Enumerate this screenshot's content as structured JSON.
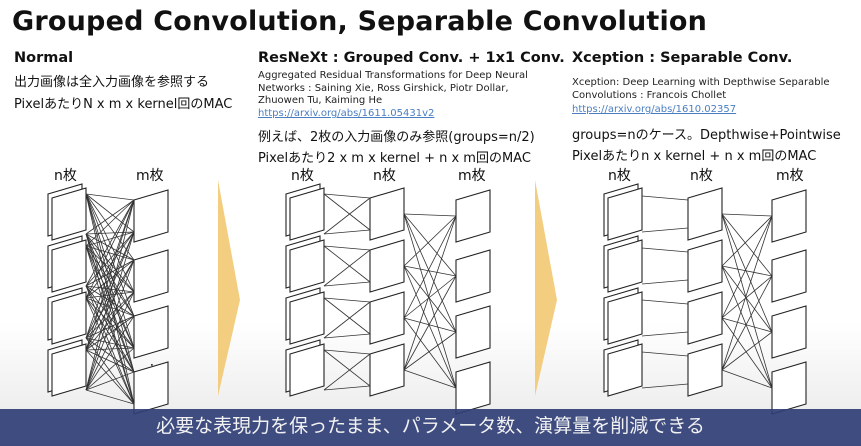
{
  "slide": {
    "title": "Grouped Convolution, Separable Convolution",
    "normal": {
      "heading": "Normal",
      "line1": "出力画像は全入力画像を参照する",
      "line2": "PixelあたりN x m x kernel回のMAC"
    },
    "resnext": {
      "heading": "ResNeXt : Grouped Conv. + 1x1 Conv.",
      "citation_1": "Aggregated Residual Transformations for Deep Neural",
      "citation_2": "Networks : Saining Xie, Ross Girshick, Piotr Dollar,",
      "citation_3": "Zhuowen Tu, Kaiming He",
      "link": "https://arxiv.org/abs/1611.05431v2",
      "line1": "例えば、2枚の入力画像のみ参照(groups=n/2)",
      "line2": "Pixelあたり2 x m x kernel + n x m回のMAC"
    },
    "xception": {
      "heading": "Xception : Separable Conv.",
      "citation_1": "Xception: Deep Learning with Depthwise Separable",
      "citation_2": "Convolutions : Francois Chollet",
      "link": "https://arxiv.org/abs/1610.02357",
      "line1": "groups=nのケース。Depthwise+Pointwise",
      "line2": "Pixelあたりn x kernel + n x m回のMAC"
    },
    "labels": {
      "n": "n枚",
      "m": "m枚",
      "dots": "⋮"
    },
    "caption": "必要な表現力を保ったまま、パラメータ数、演算量を削減できる",
    "colors": {
      "arrow": "#f2c56a",
      "caption_bg": "#303e76",
      "link": "#4a7ec2"
    }
  }
}
